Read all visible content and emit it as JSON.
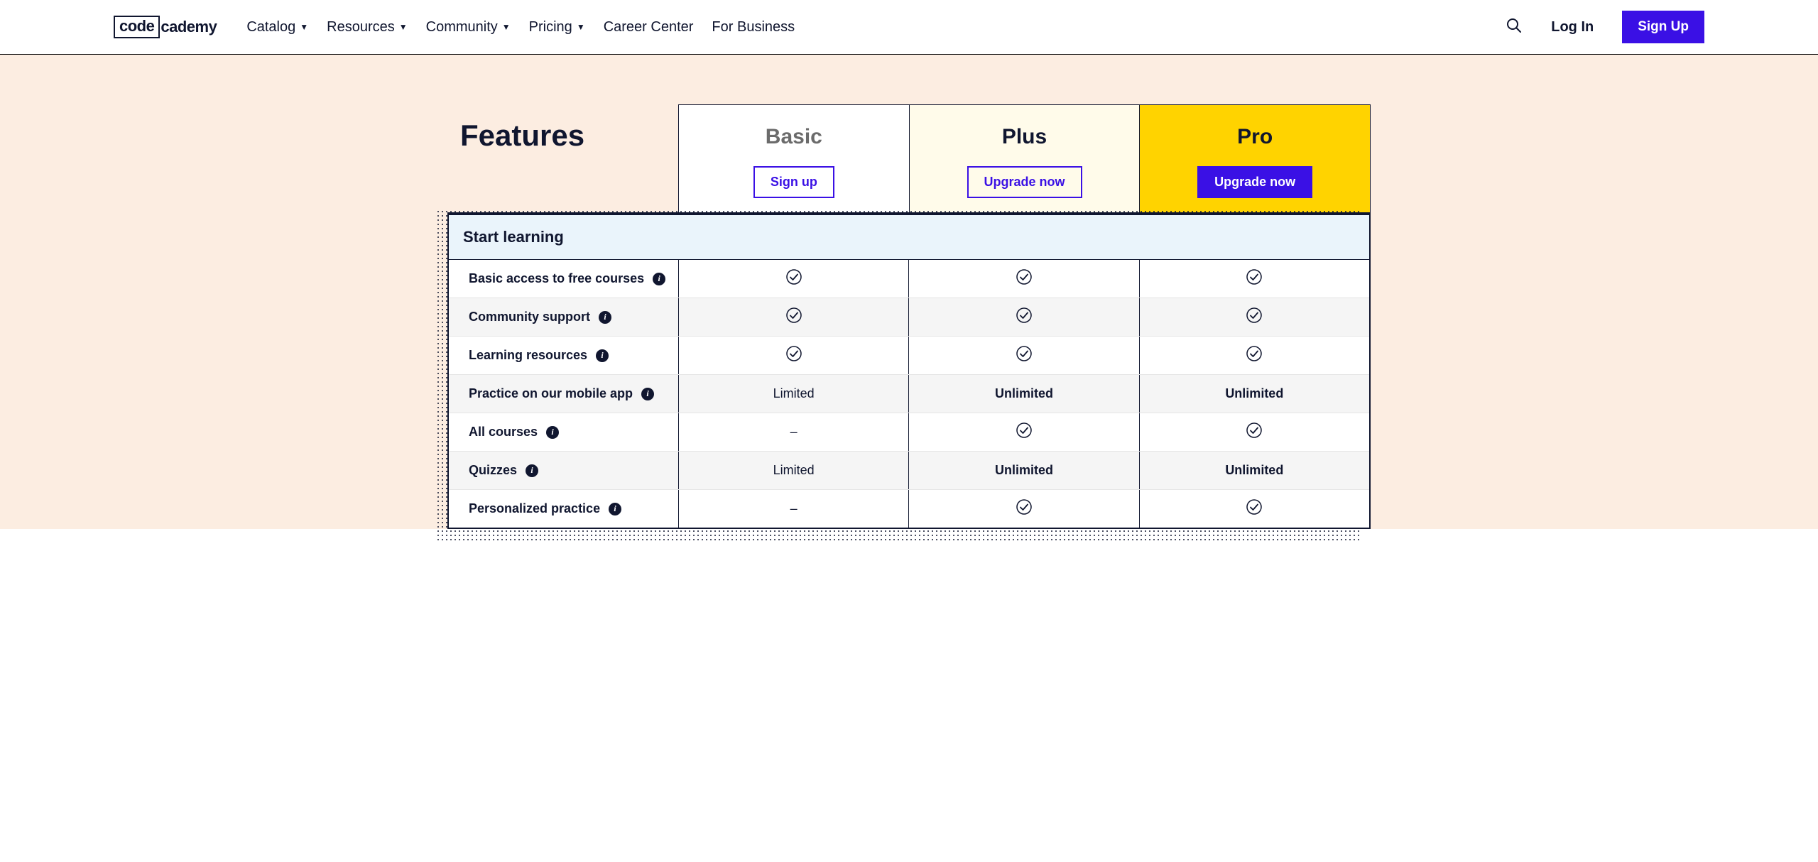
{
  "header": {
    "logo_part1": "code",
    "logo_part2": "cademy",
    "nav": {
      "catalog": "Catalog",
      "resources": "Resources",
      "community": "Community",
      "pricing": "Pricing",
      "career": "Career Center",
      "business": "For Business"
    },
    "login": "Log In",
    "signup": "Sign Up"
  },
  "page": {
    "features_title": "Features"
  },
  "plans": {
    "basic": {
      "name": "Basic",
      "cta": "Sign up"
    },
    "plus": {
      "name": "Plus",
      "cta": "Upgrade now"
    },
    "pro": {
      "name": "Pro",
      "cta": "Upgrade now"
    }
  },
  "section": {
    "start_learning": "Start learning"
  },
  "rows": {
    "r0": {
      "label": "Basic access to free courses",
      "basic": "check",
      "plus": "check",
      "pro": "check"
    },
    "r1": {
      "label": "Community support",
      "basic": "check",
      "plus": "check",
      "pro": "check"
    },
    "r2": {
      "label": "Learning resources",
      "basic": "check",
      "plus": "check",
      "pro": "check"
    },
    "r3": {
      "label": "Practice on our mobile app",
      "basic": "Limited",
      "plus": "Unlimited",
      "pro": "Unlimited"
    },
    "r4": {
      "label": "All courses",
      "basic": "–",
      "plus": "check",
      "pro": "check"
    },
    "r5": {
      "label": "Quizzes",
      "basic": "Limited",
      "plus": "Unlimited",
      "pro": "Unlimited"
    },
    "r6": {
      "label": "Personalized practice",
      "basic": "–",
      "plus": "check",
      "pro": "check"
    }
  }
}
